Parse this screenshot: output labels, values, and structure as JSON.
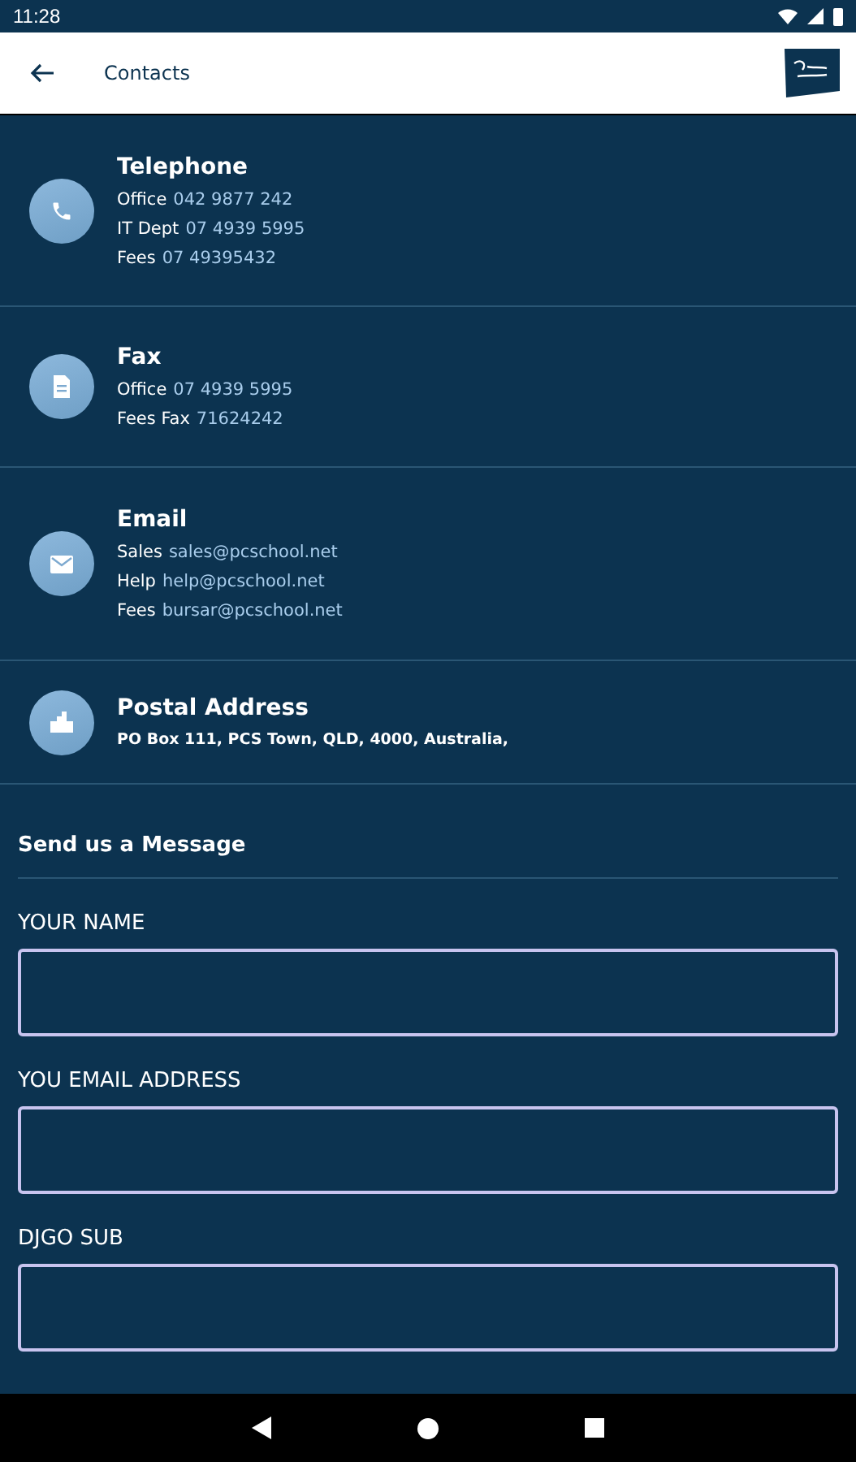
{
  "status_bar": {
    "time": "11:28"
  },
  "header": {
    "title": "Contacts"
  },
  "contacts": [
    {
      "kind": "phone",
      "title": "Telephone",
      "lines": [
        {
          "label": "Office",
          "value": "042 9877 242"
        },
        {
          "label": "IT Dept",
          "value": "07 4939 5995"
        },
        {
          "label": "Fees",
          "value": "07 49395432"
        }
      ]
    },
    {
      "kind": "fax",
      "title": "Fax",
      "lines": [
        {
          "label": "Office",
          "value": "07 4939 5995"
        },
        {
          "label": "Fees Fax",
          "value": "71624242"
        }
      ]
    },
    {
      "kind": "email",
      "title": "Email",
      "lines": [
        {
          "label": "Sales",
          "value": "sales@pcschool.net"
        },
        {
          "label": "Help",
          "value": "help@pcschool.net"
        },
        {
          "label": "Fees",
          "value": "bursar@pcschool.net"
        }
      ]
    },
    {
      "kind": "address",
      "title": "Postal Address",
      "text": "PO Box 111, PCS Town, QLD, 4000, Australia,"
    }
  ],
  "form": {
    "title": "Send us a Message",
    "fields": [
      {
        "label": "YOUR NAME"
      },
      {
        "label": "YOU EMAIL ADDRESS"
      },
      {
        "label": "DJGO SUB"
      }
    ]
  }
}
